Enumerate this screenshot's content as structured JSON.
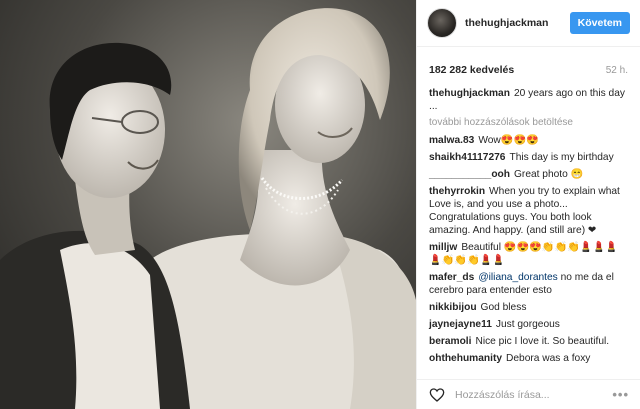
{
  "post": {
    "username": "thehughjackman",
    "follow_label": "Követem",
    "likes": "182 282 kedvelés",
    "time": "52 h."
  },
  "caption": {
    "username": "thehughjackman",
    "text": "20 years ago on this day ..."
  },
  "load_more": "további hozzászólások betöltése",
  "comments": [
    {
      "user": "malwa.83",
      "text": "Wow😍😍😍"
    },
    {
      "user": "shaikh41117276",
      "text": "This day is my birthday"
    },
    {
      "user": "___________ooh",
      "text": "Great photo 😁"
    },
    {
      "user": "thehyrrokin",
      "text": "When you try to explain what Love is, and you use a photo... Congratulations guys. You both look amazing. And happy. (and still are) ❤"
    },
    {
      "user": "milljw",
      "text": "Beautiful 😍😍😍👏👏👏💄💄💄💄👏👏👏💄💄"
    },
    {
      "user": "mafer_ds",
      "mention": "@iliana_dorantes",
      "text": "no me da el cerebro para entender esto"
    },
    {
      "user": "nikkibijou",
      "text": "God bless"
    },
    {
      "user": "jaynejayne11",
      "text": "Just gorgeous"
    },
    {
      "user": "beramoli",
      "text": "Nice pic I love it. So beautiful."
    },
    {
      "user": "ohthehumanity",
      "text": "Debora was a foxy"
    }
  ],
  "footer": {
    "placeholder": "Hozzászólás írása...",
    "options_icon": "more-options-icon",
    "like_icon": "heart-icon"
  },
  "colors": {
    "accent": "#3897f0",
    "border": "#efefef",
    "muted": "#999999"
  }
}
